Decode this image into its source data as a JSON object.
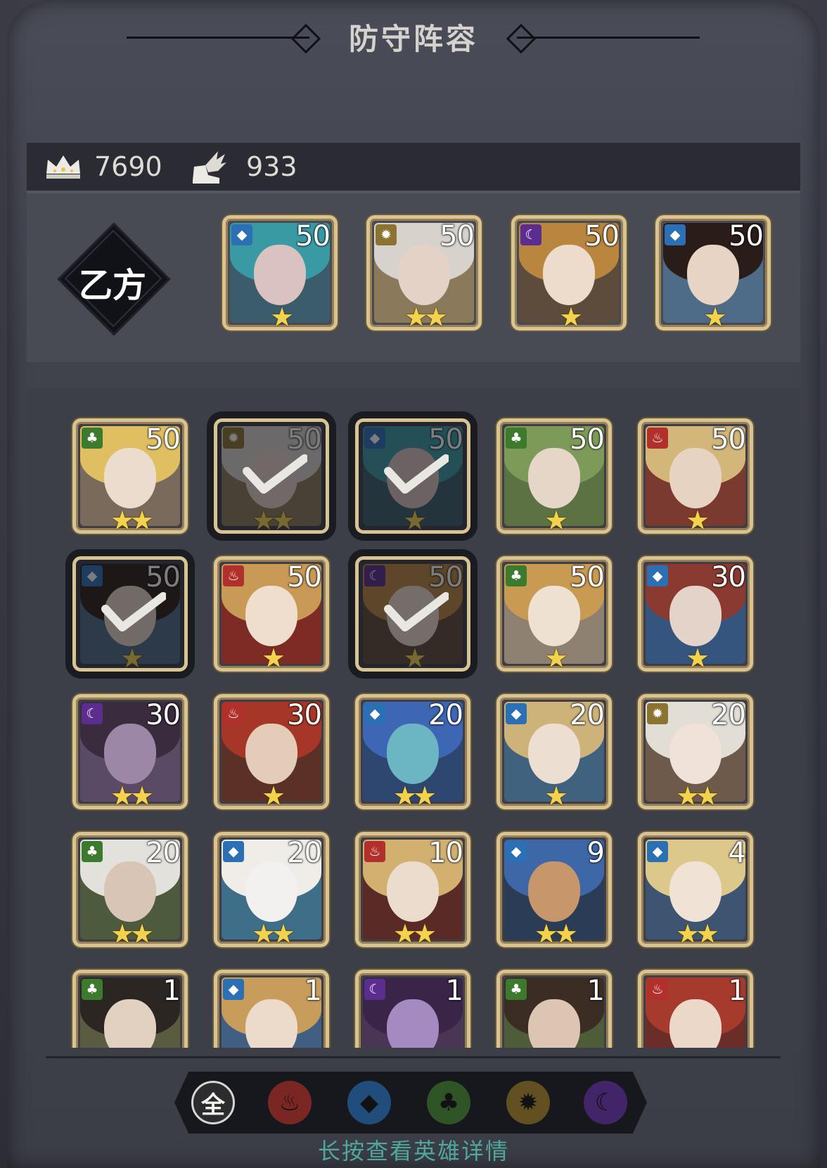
{
  "title": "防守阵容",
  "stats": {
    "power": "7690",
    "speed": "933"
  },
  "team": {
    "label": "乙方",
    "members": [
      {
        "element": "water",
        "level": "50",
        "stars": "★",
        "hair": "#3a9aa3",
        "skin": "#d9c2bf",
        "bg": "#3b5d6b"
      },
      {
        "element": "light",
        "level": "50",
        "stars": "★★",
        "hair": "#d7d3cc",
        "skin": "#e4d2c7",
        "bg": "#8a7a5b"
      },
      {
        "element": "dark",
        "level": "50",
        "stars": "★",
        "hair": "#b8863e",
        "skin": "#eddbcc",
        "bg": "#5d4b3b"
      },
      {
        "element": "water",
        "level": "50",
        "stars": "★",
        "hair": "#2a1d19",
        "skin": "#e7d4c5",
        "bg": "#4e6b88"
      }
    ]
  },
  "roster": [
    {
      "element": "nature",
      "level": "50",
      "stars": "★★",
      "selected": false,
      "hair": "#e0bf62",
      "skin": "#ecdccd",
      "bg": "#7a6a5c"
    },
    {
      "element": "light",
      "level": "50",
      "stars": "★★",
      "selected": true,
      "hair": "#d7d3cc",
      "skin": "#e4d2c7",
      "bg": "#8a7a5b"
    },
    {
      "element": "water",
      "level": "50",
      "stars": "★",
      "selected": true,
      "hair": "#3a9aa3",
      "skin": "#d9c2bf",
      "bg": "#3b5d6b"
    },
    {
      "element": "nature",
      "level": "50",
      "stars": "★",
      "selected": false,
      "hair": "#7d9a58",
      "skin": "#e5d6c8",
      "bg": "#5d7243"
    },
    {
      "element": "fire",
      "level": "50",
      "stars": "★",
      "selected": false,
      "hair": "#d2b67a",
      "skin": "#e7d3c1",
      "bg": "#7b3a2f"
    },
    {
      "element": "water",
      "level": "50",
      "stars": "★",
      "selected": true,
      "hair": "#2a1d19",
      "skin": "#e7d4c5",
      "bg": "#4e6b88"
    },
    {
      "element": "fire",
      "level": "50",
      "stars": "★",
      "selected": false,
      "hair": "#c99a55",
      "skin": "#efddcd",
      "bg": "#7e2a25"
    },
    {
      "element": "dark",
      "level": "50",
      "stars": "★",
      "selected": true,
      "hair": "#b8863e",
      "skin": "#eddbcc",
      "bg": "#5d4b3b"
    },
    {
      "element": "nature",
      "level": "50",
      "stars": "★",
      "selected": false,
      "hair": "#c99b52",
      "skin": "#efe1d2",
      "bg": "#8e8172"
    },
    {
      "element": "water",
      "level": "30",
      "stars": "★",
      "selected": false,
      "hair": "#8a3a30",
      "skin": "#e3d3c8",
      "bg": "#36557e"
    },
    {
      "element": "dark",
      "level": "30",
      "stars": "★★",
      "selected": false,
      "hair": "#3b2b3e",
      "skin": "#9d87a6",
      "bg": "#5b4a66"
    },
    {
      "element": "fire",
      "level": "30",
      "stars": "★",
      "selected": false,
      "hair": "#a63628",
      "skin": "#e4cdb8",
      "bg": "#5a3027"
    },
    {
      "element": "water",
      "level": "20",
      "stars": "★★",
      "selected": false,
      "hair": "#3d66b4",
      "skin": "#6cb5c2",
      "bg": "#2d4770"
    },
    {
      "element": "water",
      "level": "20",
      "stars": "★",
      "selected": false,
      "hair": "#cdb27a",
      "skin": "#ecdfd2",
      "bg": "#41627e"
    },
    {
      "element": "light",
      "level": "20",
      "stars": "★★",
      "selected": false,
      "hair": "#e2ded6",
      "skin": "#f0e2d8",
      "bg": "#6e5a4a"
    },
    {
      "element": "nature",
      "level": "20",
      "stars": "★★",
      "selected": false,
      "hair": "#e3e1dc",
      "skin": "#d8c5b6",
      "bg": "#4d5a3d"
    },
    {
      "element": "water",
      "level": "20",
      "stars": "★★",
      "selected": false,
      "hair": "#f0ede8",
      "skin": "#f3f1ef",
      "bg": "#3f6e88"
    },
    {
      "element": "fire",
      "level": "10",
      "stars": "★★",
      "selected": false,
      "hair": "#d2b06f",
      "skin": "#ecdccd",
      "bg": "#5a2a27"
    },
    {
      "element": "water",
      "level": "9",
      "stars": "★★",
      "selected": false,
      "hair": "#3e67a8",
      "skin": "#c8966b",
      "bg": "#2b3c56"
    },
    {
      "element": "water",
      "level": "4",
      "stars": "★★",
      "selected": false,
      "hair": "#dcc88a",
      "skin": "#f0e3d5",
      "bg": "#3d5570"
    },
    {
      "element": "nature",
      "level": "1",
      "stars": "★",
      "selected": false,
      "hair": "#2b2622",
      "skin": "#e2d1c1",
      "bg": "#5a5c40"
    },
    {
      "element": "water",
      "level": "1",
      "stars": "★",
      "selected": false,
      "hair": "#c89d5c",
      "skin": "#ecdacb",
      "bg": "#415f83"
    },
    {
      "element": "dark",
      "level": "1",
      "stars": "★",
      "selected": false,
      "hair": "#3a2448",
      "skin": "#a58ac0",
      "bg": "#4a3555"
    },
    {
      "element": "nature",
      "level": "1",
      "stars": "★",
      "selected": false,
      "hair": "#3b2d24",
      "skin": "#dcc6b3",
      "bg": "#4e5c3a"
    },
    {
      "element": "fire",
      "level": "1",
      "stars": "★",
      "selected": false,
      "hair": "#a63a2c",
      "skin": "#ecd8c8",
      "bg": "#6b2d27"
    }
  ],
  "filters": [
    {
      "id": "all",
      "label": "全",
      "icon": "all-filter-icon"
    },
    {
      "id": "fire",
      "icon": "fire-filter-icon",
      "color": "#9c2b25"
    },
    {
      "id": "water",
      "icon": "water-filter-icon",
      "color": "#245f9c"
    },
    {
      "id": "nature",
      "icon": "nature-filter-icon",
      "color": "#37682a"
    },
    {
      "id": "light",
      "icon": "light-filter-icon",
      "color": "#7c6325"
    },
    {
      "id": "dark",
      "icon": "dark-filter-icon",
      "color": "#4f2a82"
    }
  ],
  "hint": "长按查看英雄详情",
  "colors": {
    "accent_text": "#4fa79d",
    "frame_gold": "#d8c493"
  }
}
